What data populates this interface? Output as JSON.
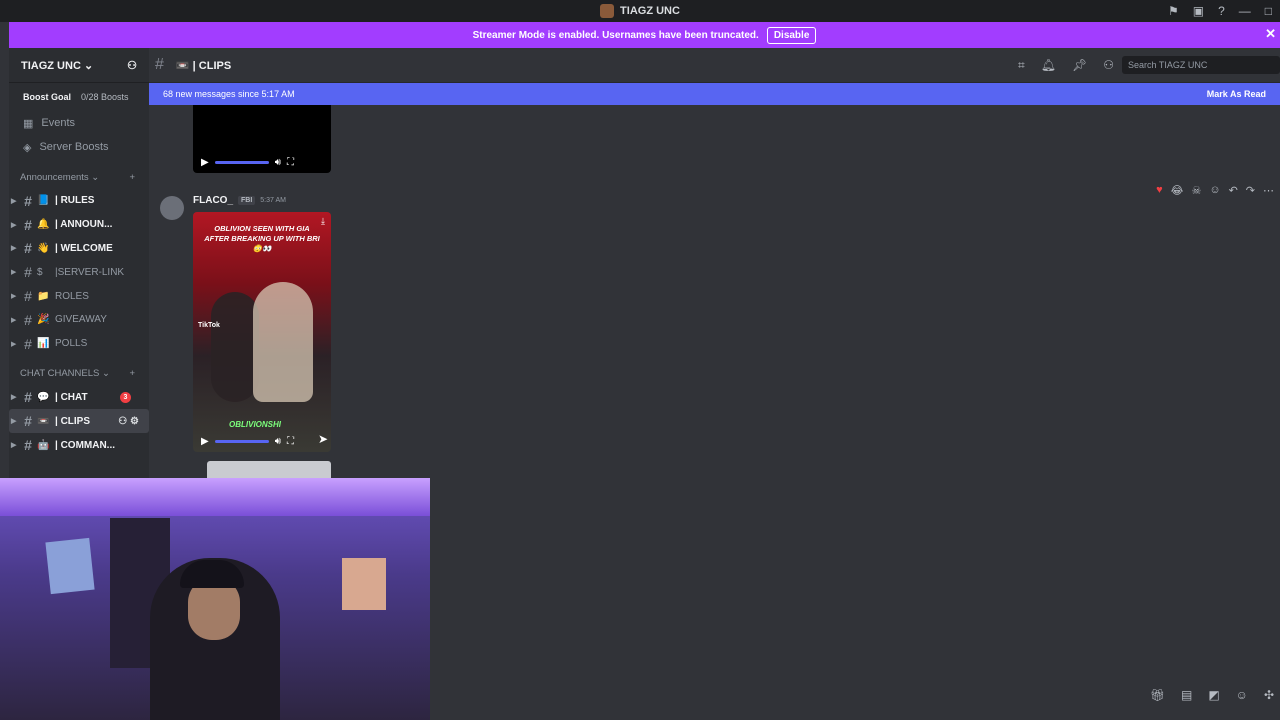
{
  "window": {
    "title": "TIAGZ UNC"
  },
  "streamer": {
    "text": "Streamer Mode is enabled. Usernames have been truncated.",
    "disable_label": "Disable"
  },
  "server": {
    "name": "TIAGZ UNC",
    "boost_goal": "Boost Goal",
    "boost_count": "0/28 Boosts"
  },
  "nav": {
    "events": "Events",
    "server_boosts": "Server Boosts"
  },
  "categories": {
    "announcements": "Announcements",
    "chat_channels": "CHAT CHANNELS"
  },
  "channels": [
    {
      "emoji": "📘",
      "name": "| RULES"
    },
    {
      "emoji": "🔔",
      "name": "| ANNOUN..."
    },
    {
      "emoji": "👋",
      "name": "| WELCOME"
    },
    {
      "emoji": "$",
      "name": "|SERVER-LINK"
    },
    {
      "emoji": "📁",
      "name": "ROLES"
    },
    {
      "emoji": "🎉",
      "name": "GIVEAWAY"
    },
    {
      "emoji": "📊",
      "name": "POLLS"
    }
  ],
  "chat_channels": [
    {
      "emoji": "💬",
      "name": "| CHAT",
      "badge": "3"
    },
    {
      "emoji": "📼",
      "name": "| CLIPS"
    },
    {
      "emoji": "🤖",
      "name": "| COMMAN..."
    }
  ],
  "topbar": {
    "channel": "| CLIPS",
    "search_placeholder": "Search TIAGZ UNC"
  },
  "new_messages": {
    "text": "68 new messages since 5:17 AM",
    "mark_read": "Mark As Read"
  },
  "message": {
    "author": "FLACO_",
    "tag": "FBI",
    "time": "5:37 AM"
  },
  "video": {
    "caption": "OBLIVION SEEN WITH GIA AFTER BREAKING UP WITH BRI 😳👀",
    "platform": "TikTok",
    "label": "OBLIVIONSHI"
  },
  "colors": {
    "accent": "#5865f2",
    "streamer_bar": "#a23dff",
    "badge": "#f23f43"
  }
}
